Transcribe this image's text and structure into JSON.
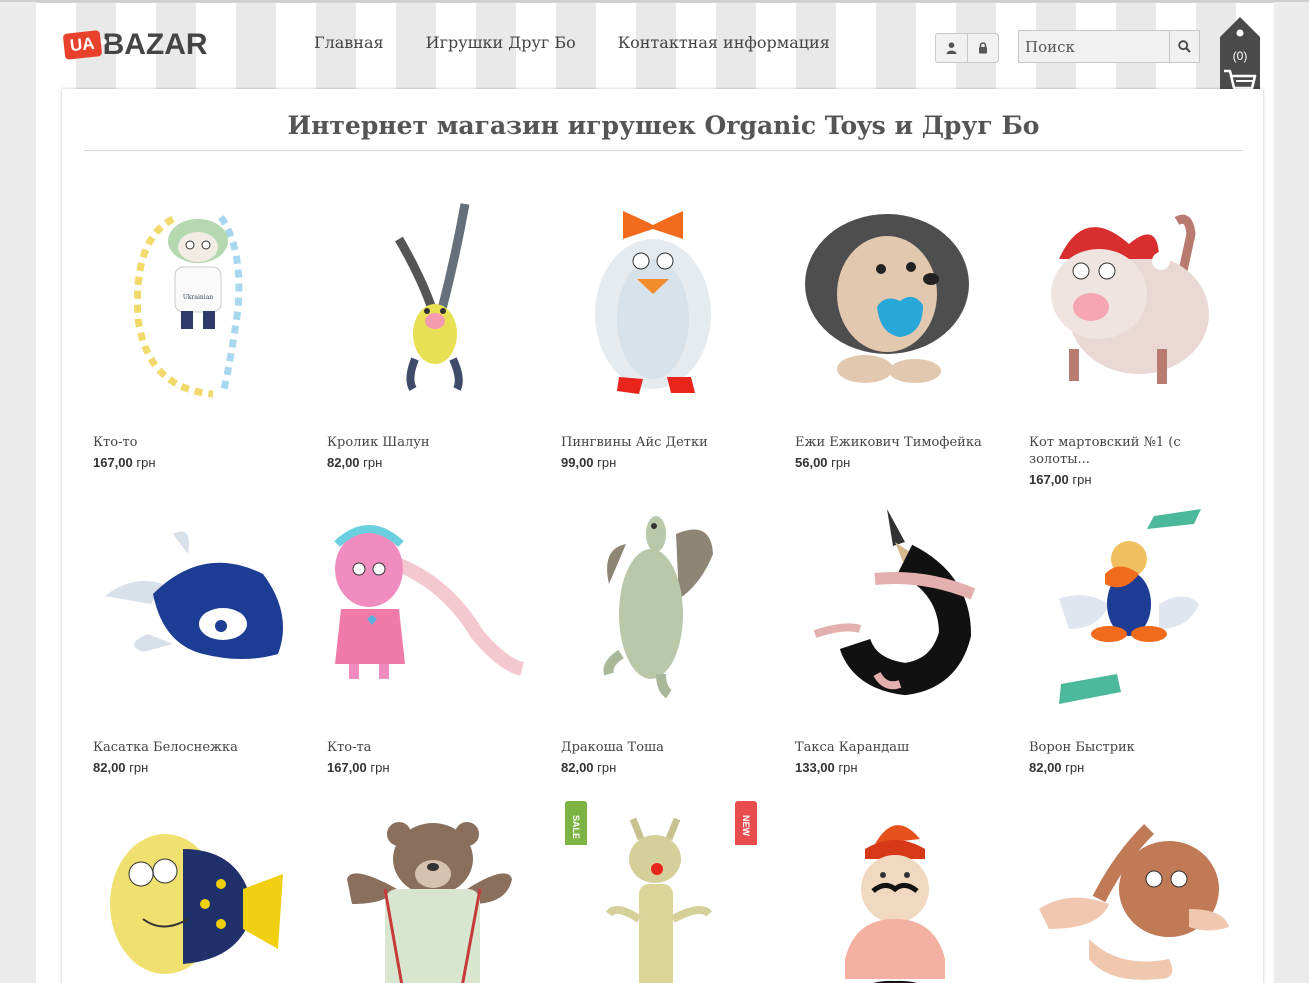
{
  "header": {
    "logo_ua": "UA",
    "logo_bazar": "BAZAR",
    "nav": [
      "Главная",
      "Игрушки Друг Бо",
      "Контактная информация"
    ],
    "search_placeholder": "Поиск",
    "cart_count": "(0)"
  },
  "main": {
    "title": "Интернет магазин игрушек Organic Toys и Друг Бо"
  },
  "products": [
    {
      "name": "Кто-то",
      "price_value": "167,00",
      "currency": "грн"
    },
    {
      "name": "Кролик Шалун",
      "price_value": "82,00",
      "currency": "грн"
    },
    {
      "name": "Пингвины Айс Детки",
      "price_value": "99,00",
      "currency": "грн"
    },
    {
      "name": "Ежи Ежикович Тимофейка",
      "price_value": "56,00",
      "currency": "грн"
    },
    {
      "name": "Кот мартовский №1 (с золоты...",
      "price_value": "167,00",
      "currency": "грн"
    },
    {
      "name": "Касатка Белоснежка",
      "price_value": "82,00",
      "currency": "грн"
    },
    {
      "name": "Кто-та",
      "price_value": "167,00",
      "currency": "грн"
    },
    {
      "name": "Дракоша Тоша",
      "price_value": "82,00",
      "currency": "грн"
    },
    {
      "name": "Такса Карандаш",
      "price_value": "133,00",
      "currency": "грн"
    },
    {
      "name": "Ворон Быстрик",
      "price_value": "82,00",
      "currency": "грн"
    }
  ],
  "badges": {
    "sale": "SALE",
    "new": "NEW"
  },
  "colors": {
    "logo_red": "#e8412c",
    "cart_dark": "#4a4a4a",
    "sale_green": "#7cb342",
    "new_red": "#e84c4c"
  },
  "icons": [
    "user-icon",
    "lock-icon",
    "search-icon",
    "cart-icon"
  ]
}
